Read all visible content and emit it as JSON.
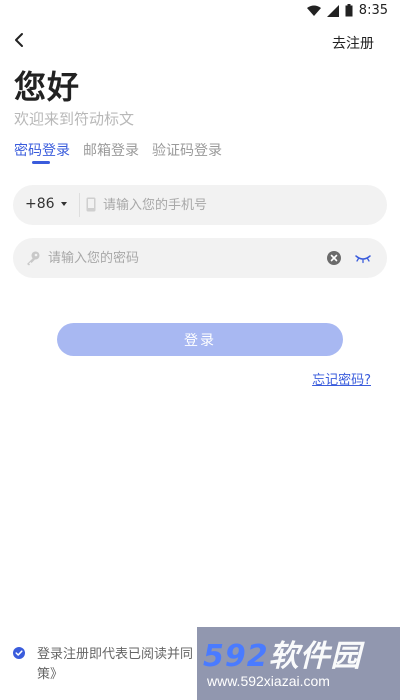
{
  "status_bar": {
    "time": "8:35",
    "icons": [
      "wifi-icon",
      "signal-icon",
      "battery-icon"
    ]
  },
  "header": {
    "register_label": "去注册"
  },
  "greeting": "您好",
  "welcome": "欢迎来到符动标文",
  "tabs": [
    {
      "label": "密码登录",
      "active": true
    },
    {
      "label": "邮箱登录",
      "active": false
    },
    {
      "label": "验证码登录",
      "active": false
    }
  ],
  "phone": {
    "country_code": "+86",
    "value": "",
    "placeholder": "请输入您的手机号"
  },
  "password": {
    "value": "",
    "placeholder": "请输入您的密码"
  },
  "login_button": "登录",
  "forgot_password": "忘记密码?",
  "agreement": {
    "checked": true,
    "text": "登录注册即代表已阅读并同",
    "text_end": "策》"
  },
  "watermark": {
    "brand_num": "592",
    "brand_text": "软件园",
    "url": "www.592xiazai.com"
  },
  "colors": {
    "accent": "#3a5cdc",
    "button_disabled": "#a8b8f2",
    "field_bg": "#f2f2f2",
    "placeholder": "#a8a8a8"
  }
}
